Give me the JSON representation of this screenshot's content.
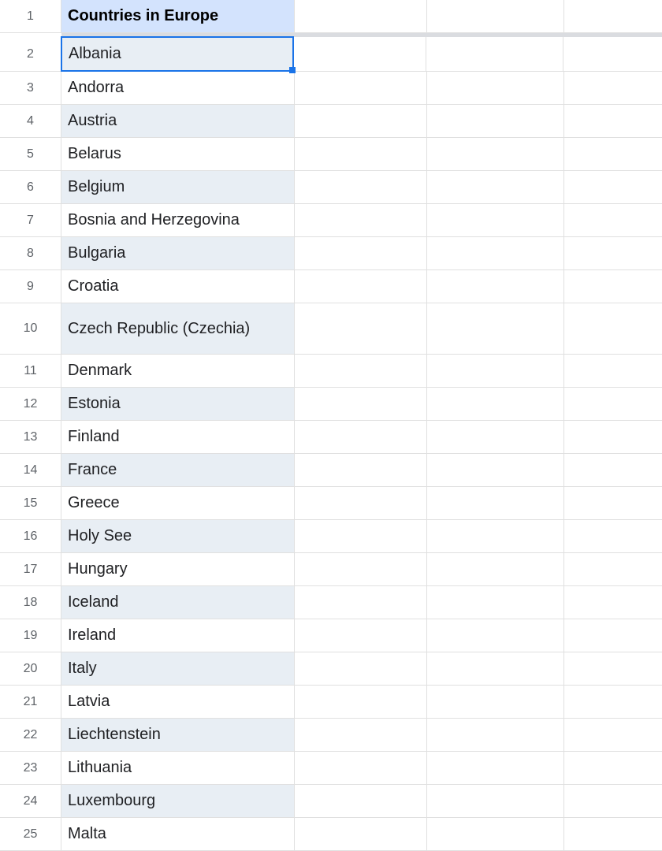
{
  "sheet": {
    "header": "Countries in Europe",
    "rows": [
      {
        "num": 1,
        "value": "Countries in Europe",
        "header": true
      },
      {
        "num": 2,
        "value": "Albania",
        "selected": true,
        "alt": true
      },
      {
        "num": 3,
        "value": "Andorra"
      },
      {
        "num": 4,
        "value": "Austria",
        "alt": true
      },
      {
        "num": 5,
        "value": "Belarus"
      },
      {
        "num": 6,
        "value": "Belgium",
        "alt": true
      },
      {
        "num": 7,
        "value": "Bosnia and Herzegovina"
      },
      {
        "num": 8,
        "value": "Bulgaria",
        "alt": true
      },
      {
        "num": 9,
        "value": "Croatia"
      },
      {
        "num": 10,
        "value": "Czech Republic (Czechia)",
        "alt": true,
        "tall": true
      },
      {
        "num": 11,
        "value": "Denmark"
      },
      {
        "num": 12,
        "value": "Estonia",
        "alt": true
      },
      {
        "num": 13,
        "value": "Finland"
      },
      {
        "num": 14,
        "value": "France",
        "alt": true
      },
      {
        "num": 15,
        "value": "Greece"
      },
      {
        "num": 16,
        "value": "Holy See",
        "alt": true
      },
      {
        "num": 17,
        "value": "Hungary"
      },
      {
        "num": 18,
        "value": "Iceland",
        "alt": true
      },
      {
        "num": 19,
        "value": "Ireland"
      },
      {
        "num": 20,
        "value": "Italy",
        "alt": true
      },
      {
        "num": 21,
        "value": "Latvia"
      },
      {
        "num": 22,
        "value": "Liechtenstein",
        "alt": true
      },
      {
        "num": 23,
        "value": "Lithuania"
      },
      {
        "num": 24,
        "value": "Luxembourg",
        "alt": true
      },
      {
        "num": 25,
        "value": "Malta"
      }
    ]
  }
}
